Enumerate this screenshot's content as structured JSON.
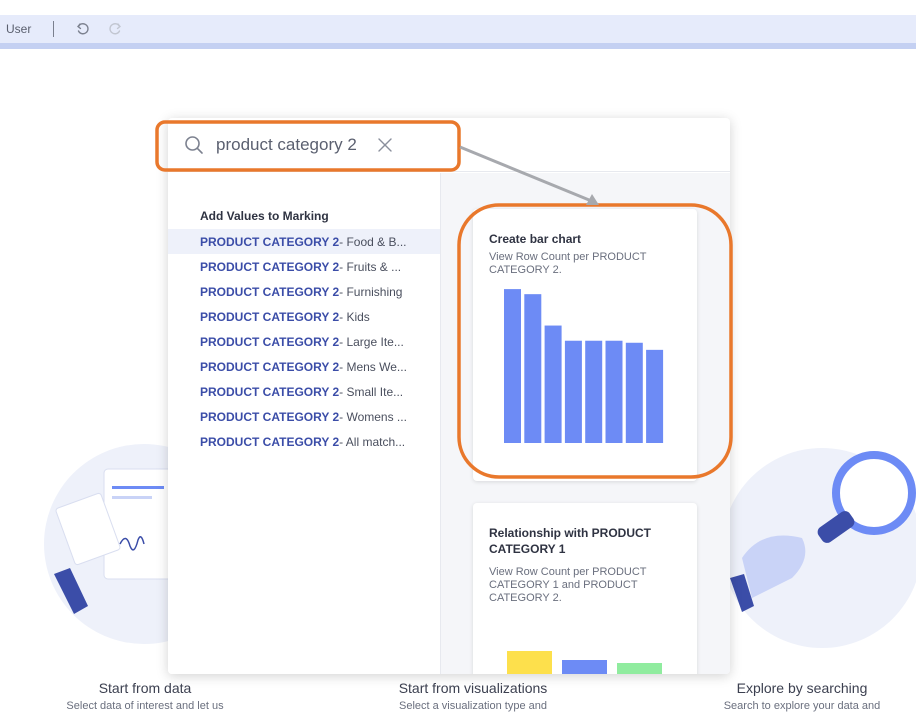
{
  "topbar": {
    "user_label": "User",
    "undo_icon": "undo-icon",
    "redo_icon": "redo-icon"
  },
  "search": {
    "value": "product category 2",
    "placeholder": ""
  },
  "marking": {
    "header": "Add Values to Marking",
    "items": [
      {
        "key": "PRODUCT CATEGORY 2",
        "value": " - Food & B..."
      },
      {
        "key": "PRODUCT CATEGORY 2",
        "value": " - Fruits & ..."
      },
      {
        "key": "PRODUCT CATEGORY 2",
        "value": " - Furnishing"
      },
      {
        "key": "PRODUCT CATEGORY 2",
        "value": " - Kids"
      },
      {
        "key": "PRODUCT CATEGORY 2",
        "value": " - Large Ite..."
      },
      {
        "key": "PRODUCT CATEGORY 2",
        "value": " - Mens We..."
      },
      {
        "key": "PRODUCT CATEGORY 2",
        "value": " - Small Ite..."
      },
      {
        "key": "PRODUCT CATEGORY 2",
        "value": " - Womens ..."
      },
      {
        "key": "PRODUCT CATEGORY 2",
        "value": " - All match..."
      }
    ]
  },
  "cards": {
    "bar_card": {
      "title": "Create bar chart",
      "description": "View Row Count per PRODUCT CATEGORY 2."
    },
    "relationship_card": {
      "title": "Relationship with PRODUCT CATEGORY 1",
      "description": "View Row Count per PRODUCT CATEGORY 1 and PRODUCT CATEGORY 2."
    }
  },
  "chart_data": [
    {
      "type": "bar",
      "values": [
        152,
        147,
        116,
        101,
        101,
        101,
        99,
        92
      ],
      "ylim": [
        0,
        160
      ],
      "color": "#6d8bf5"
    },
    {
      "type": "bar",
      "values": [
        44,
        35,
        32
      ],
      "ylim": [
        0,
        50
      ],
      "colors": [
        "#fde04c",
        "#6d8bf5",
        "#90ec9f"
      ]
    }
  ],
  "features": [
    {
      "title": "Start from data",
      "subtitle": "Select data of interest and let us"
    },
    {
      "title": "Start from visualizations",
      "subtitle": "Select a visualization type and"
    },
    {
      "title": "Explore by searching",
      "subtitle": "Search to explore your data and"
    }
  ],
  "colors": {
    "accent": "#3b4da8",
    "highlight_outline": "#e9782c",
    "bar_blue": "#6d8bf5"
  }
}
